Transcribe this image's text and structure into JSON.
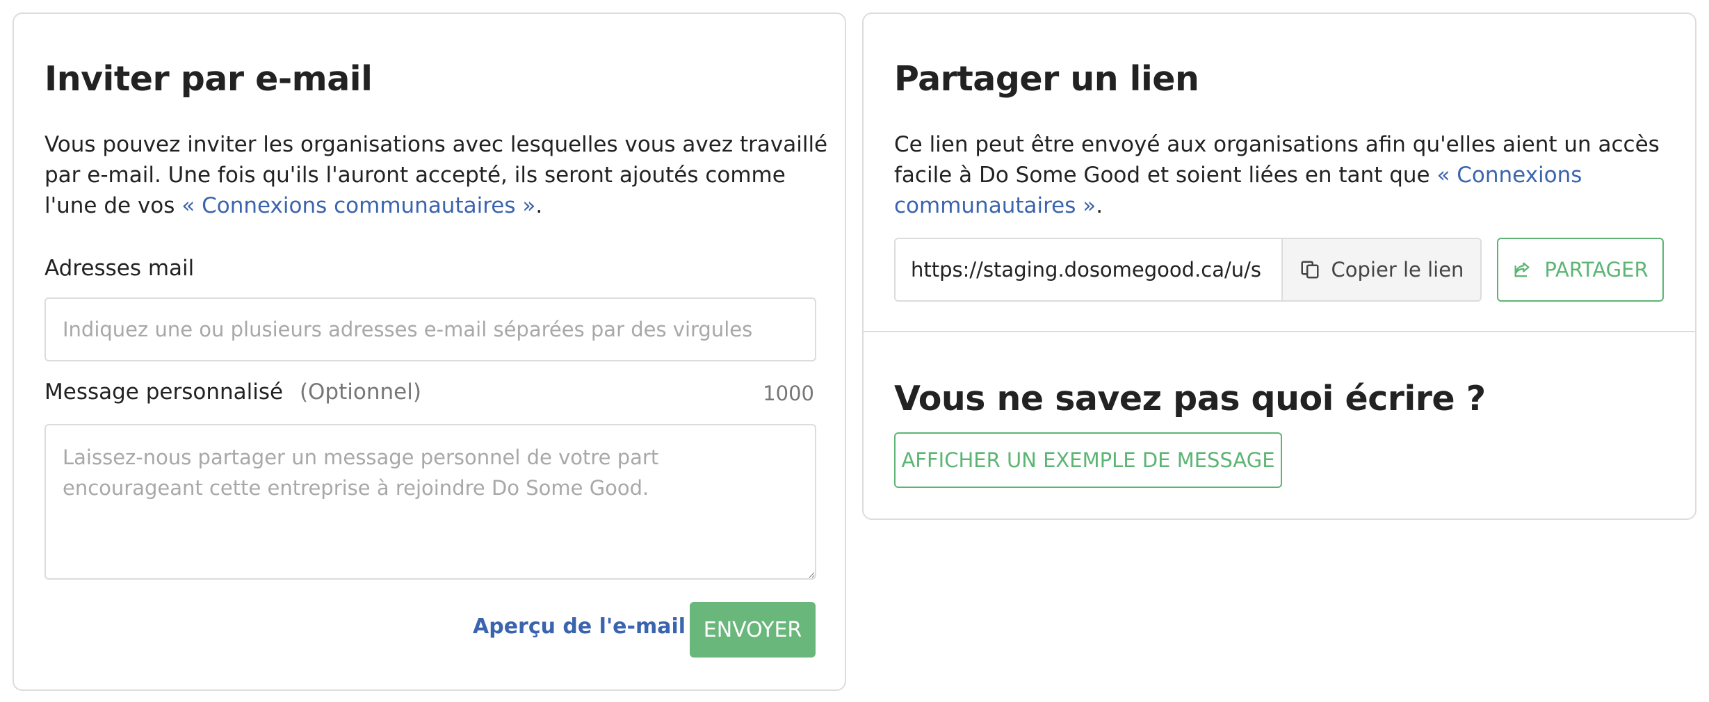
{
  "invite_email": {
    "title": "Inviter par e-mail",
    "description_part1": "Vous pouvez inviter les organisations avec lesquelles vous avez travaillé par e-mail. Une fois qu'ils l'auront accepté, ils seront ajoutés comme l'une de vos ",
    "description_link": "« Connexions communautaires »",
    "description_part2": ".",
    "emails_label": "Adresses mail",
    "emails_placeholder": "Indiquez une ou plusieurs adresses e-mail séparées par des virgules",
    "emails_value": "",
    "message_label": "Message personnalisé",
    "message_optional": "(Optionnel)",
    "message_char_count": "1000",
    "message_placeholder": "Laissez-nous partager un message personnel de votre part encourageant cette entreprise à rejoindre Do Some Good.",
    "message_value": "",
    "preview_link": "Aperçu de l'e-mail",
    "send_button": "ENVOYER"
  },
  "share_link": {
    "title": "Partager un lien",
    "description_part1": "Ce lien peut être envoyé aux organisations afin qu'elles aient un accès facile à Do Some Good et soient liées en tant que ",
    "description_link": "« Connexions communautaires »",
    "description_part2": ".",
    "link_value": "https://staging.dosomegood.ca/u/s",
    "copy_button": "Copier le lien",
    "share_button": "PARTAGER"
  },
  "example_message": {
    "title": "Vous ne savez pas quoi écrire ?",
    "show_example_button": "AFFICHER UN EXEMPLE DE MESSAGE"
  },
  "colors": {
    "accent_green": "#5cb573",
    "link_blue": "#3a64ad",
    "border_gray": "#dcdcdc"
  },
  "icons": {
    "copy": "copy-icon",
    "share": "share-icon"
  }
}
